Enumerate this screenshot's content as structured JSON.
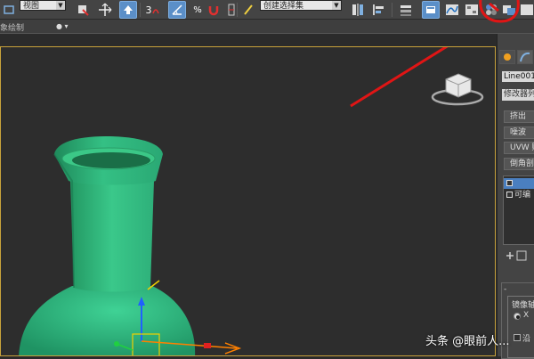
{
  "toolbar": {
    "view_combo": "视图",
    "selection_set": "创建选择集",
    "snap_angle_label": "3",
    "percent_label": "%",
    "abc_label": "ABC"
  },
  "ribbon": {
    "label": "象绘制",
    "dropdown": "● ▾"
  },
  "command_panel": {
    "object_name": "Line001",
    "modifier_list": "修改器列",
    "buttons": [
      "挤出",
      "噪波",
      "UVW 贴",
      "倒角剖"
    ],
    "stack_items": [
      {
        "label": "",
        "selected": true
      },
      {
        "label": "可编",
        "selected": false
      }
    ],
    "rollout_head": "-",
    "rollout_group_title": "镜像轴",
    "rollout_radio": "X",
    "rollout_checkbox": "沿"
  },
  "watermark": {
    "text": "头条 @眼前人..."
  },
  "colors": {
    "vase": "#2fae78",
    "annotation": "#e01515",
    "viewport_border": "#c8a23b",
    "active_button": "#5b8fc8"
  },
  "icons": [
    "select-icon",
    "move-icon",
    "snap-icon",
    "magnet-icon",
    "mirror-icon",
    "align-icon",
    "layer-icon",
    "render-setup-icon",
    "viewcube-icon"
  ]
}
